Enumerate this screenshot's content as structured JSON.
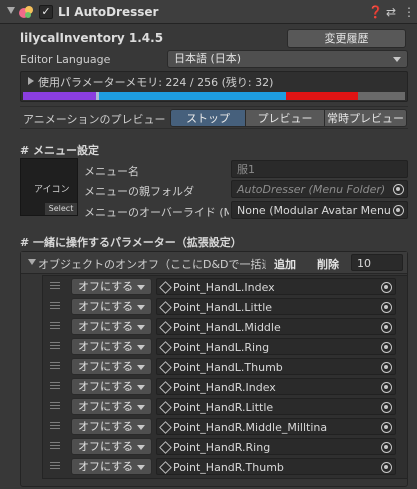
{
  "header": {
    "title": "LI AutoDresser",
    "enabled": true,
    "icons": [
      "help-icon",
      "presets-icon",
      "more-icon"
    ]
  },
  "inventory": {
    "name": "lilycalInventory 1.4.5",
    "changelog_button": "変更履歴",
    "editor_language_label": "Editor Language",
    "editor_language_value": "日本語 (日本)"
  },
  "memory": {
    "label": "使用パラメーターメモリ: 224 / 256 (残り: 32)",
    "used": 224,
    "total": 256,
    "remaining": 32,
    "segments": [
      {
        "color": "#8a3ee0",
        "fraction": 0.19
      },
      {
        "color": "#a9b9d6",
        "fraction": 0.008
      },
      {
        "color": "#1e9de0",
        "fraction": 0.49
      },
      {
        "color": "#e01414",
        "fraction": 0.19
      },
      {
        "color": "#6a6a6a",
        "fraction": 0.122
      }
    ]
  },
  "preview": {
    "label": "アニメーションのプレビュー",
    "options": [
      "ストップ",
      "プレビュー",
      "常時プレビュー"
    ],
    "selected": 0
  },
  "menu_settings": {
    "heading": "# メニュー設定",
    "icon_label": "アイコン",
    "select_label": "Select",
    "menu_name_label": "メニュー名",
    "menu_name_value": "服1",
    "parent_folder_label": "メニューの親フォルダ",
    "parent_folder_value": "AutoDresser (Menu Folder)",
    "override_label": "メニューのオーバーライド (Modu",
    "override_value": "None (Modular Avatar Menu"
  },
  "params": {
    "heading": "# 一緒に操作するパラメーター（拡張設定）",
    "onoff_label": "オブジェクトのオンオフ（ここにD&Dで一括追加",
    "add_button": "追加",
    "remove_button": "削除",
    "count": "10",
    "rows": [
      {
        "mode": "オフにする",
        "object": "Point_HandL.Index"
      },
      {
        "mode": "オフにする",
        "object": "Point_HandL.Little"
      },
      {
        "mode": "オフにする",
        "object": "Point_HandL.Middle"
      },
      {
        "mode": "オフにする",
        "object": "Point_HandL.Ring"
      },
      {
        "mode": "オフにする",
        "object": "Point_HandL.Thumb"
      },
      {
        "mode": "オフにする",
        "object": "Point_HandR.Index"
      },
      {
        "mode": "オフにする",
        "object": "Point_HandR.Little"
      },
      {
        "mode": "オフにする",
        "object": "Point_HandR.Middle_Milltina"
      },
      {
        "mode": "オフにする",
        "object": "Point_HandR.Ring"
      },
      {
        "mode": "オフにする",
        "object": "Point_HandR.Thumb"
      }
    ]
  }
}
